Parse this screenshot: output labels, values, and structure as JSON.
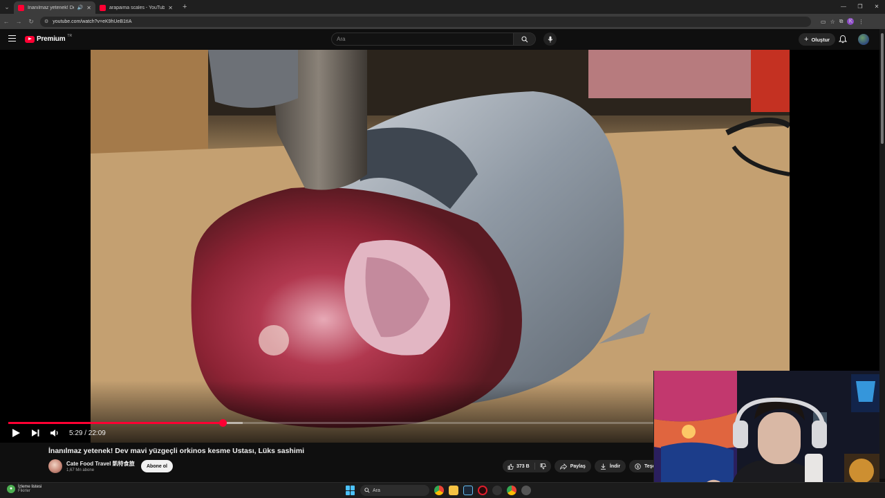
{
  "browser": {
    "tabs": [
      {
        "title": "İnanılmaz yetenek! Dev mavi yüzgeçli orkinos kesme Ustası, Lüks sashimi - YouTube",
        "active": true,
        "audio": true
      },
      {
        "title": "arapaima scales - YouTube",
        "active": false,
        "audio": false
      }
    ],
    "url": "youtube.com/watch?v=eK9hUeB1tIA",
    "profile_initial": "K"
  },
  "youtube": {
    "logo_text": "Premium",
    "logo_country": "TR",
    "search_placeholder": "Ara",
    "create_label": "Oluştur"
  },
  "player": {
    "current_time": "5:29",
    "duration": "22:09",
    "time_display": "5:29 / 22:09",
    "progress_fraction": 0.248,
    "buffered_fraction": 0.272
  },
  "video": {
    "title": "İnanılmaz yetenek!  Dev mavi yüzgeçli orkinos kesme Ustası, Lüks sashimi",
    "channel_name": "Cate Food Travel 凱特食旅",
    "subscribers": "1,67 Mn abone",
    "subscribe_label": "Abone ol",
    "likes": "373 B",
    "share_label": "Paylaş",
    "download_label": "İndir",
    "thanks_label": "Teşekk"
  },
  "taskbar": {
    "weather_line1": "İzleme listesi",
    "weather_line2": "Fikirler",
    "search_label": "Ara"
  },
  "colors": {
    "accent": "#ff0033",
    "page_bg": "#0f0f0f",
    "pill_bg": "#272727"
  },
  "icons": [
    "menu-icon",
    "search-icon",
    "mic-icon",
    "bell-icon",
    "play-icon",
    "next-icon",
    "volume-icon",
    "like-icon",
    "dislike-icon",
    "share-icon",
    "download-icon",
    "thanks-icon"
  ]
}
